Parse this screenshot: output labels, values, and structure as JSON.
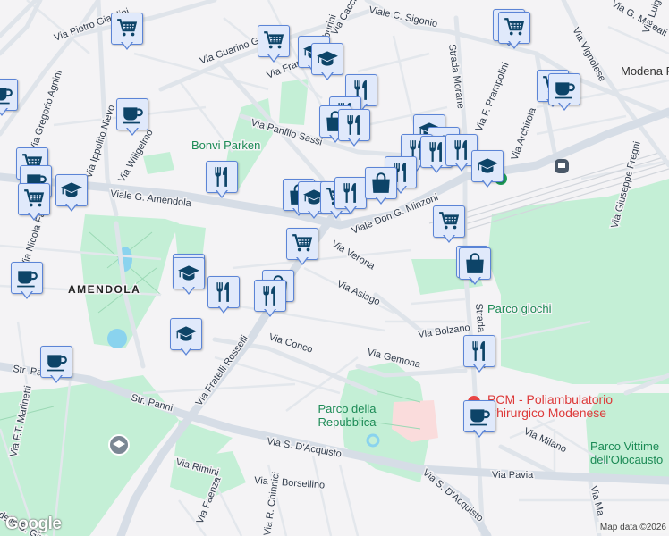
{
  "map": {
    "streets": {
      "pietro_giardini": "Via Pietro Giardini",
      "guarino_guarini": "Via Guarino Guarini",
      "sigonio": "Viale C. Sigonio",
      "morane_n": "Strada Morane",
      "morane_s": "Strada Morane",
      "vignolese": "Via Vignolese",
      "prampolini": "Via F. Prampolini",
      "archirola": "Via Archirola",
      "fregni": "Via Giuseppe Fregni",
      "panfilo_sassi": "Via Panfilo Sassi",
      "amendola": "Viale G. Amendola",
      "minzoni": "Viale Don G. Minzoni",
      "ippolito": "Via Ippolito Nievo",
      "wiligelmo": "Via Wiligelmo",
      "gregorio_agnini": "Via Gregorio Agnini",
      "nicola": "Via Nicola Fabrizi",
      "verona": "Via Verona",
      "asiago": "Via Asiago",
      "rosselli": "Via Fratelli Rosselli",
      "conco": "Via Conco",
      "bolzano": "Via Bolzano",
      "gemona": "Via Gemona",
      "str_panni_w": "Str. Panni",
      "str_panni": "Str. Panni",
      "dacquisto": "Via S. D'Acquisto",
      "dacquisto_2": "Via S. D'Acquisto",
      "pavia": "Via Pavia",
      "milano": "Via Milano",
      "rimini": "Via Rimini",
      "faenza": "Via Faenza",
      "borsellino": "Via P. Borsellino",
      "chinnici": "Via R. Chinnici",
      "marinetti": "Via F.T. Marinetti",
      "giuliano": "Stradello S. Giuliano",
      "moreali": "Via G. Moreali",
      "luigi": "Via Luigi",
      "franchi": "Via Francesco",
      "zamburini": "Via Zamburini",
      "cacciardini": "Via Cacciardini",
      "ma": "Via Ma"
    },
    "places": {
      "bonvi": "Bonvi Parken",
      "amendola_district": "AMENDOLA",
      "parco_giochi": "Parco giochi",
      "parco_repubblica": "Parco della Repubblica",
      "parco_vittime": "Parco Vittime dell'Olocausto",
      "modena": "Modena P",
      "pcm": "PCM - Poliambulatorio Chirurgico Modenese"
    },
    "attribution": "Map data ©2026",
    "logo": "Google",
    "colors": {
      "marker_bg": "#e0e9fb",
      "marker_border": "#5b84d6",
      "marker_icon": "#0d4468",
      "park": "#c4efd6",
      "poi": "#e94545"
    }
  }
}
